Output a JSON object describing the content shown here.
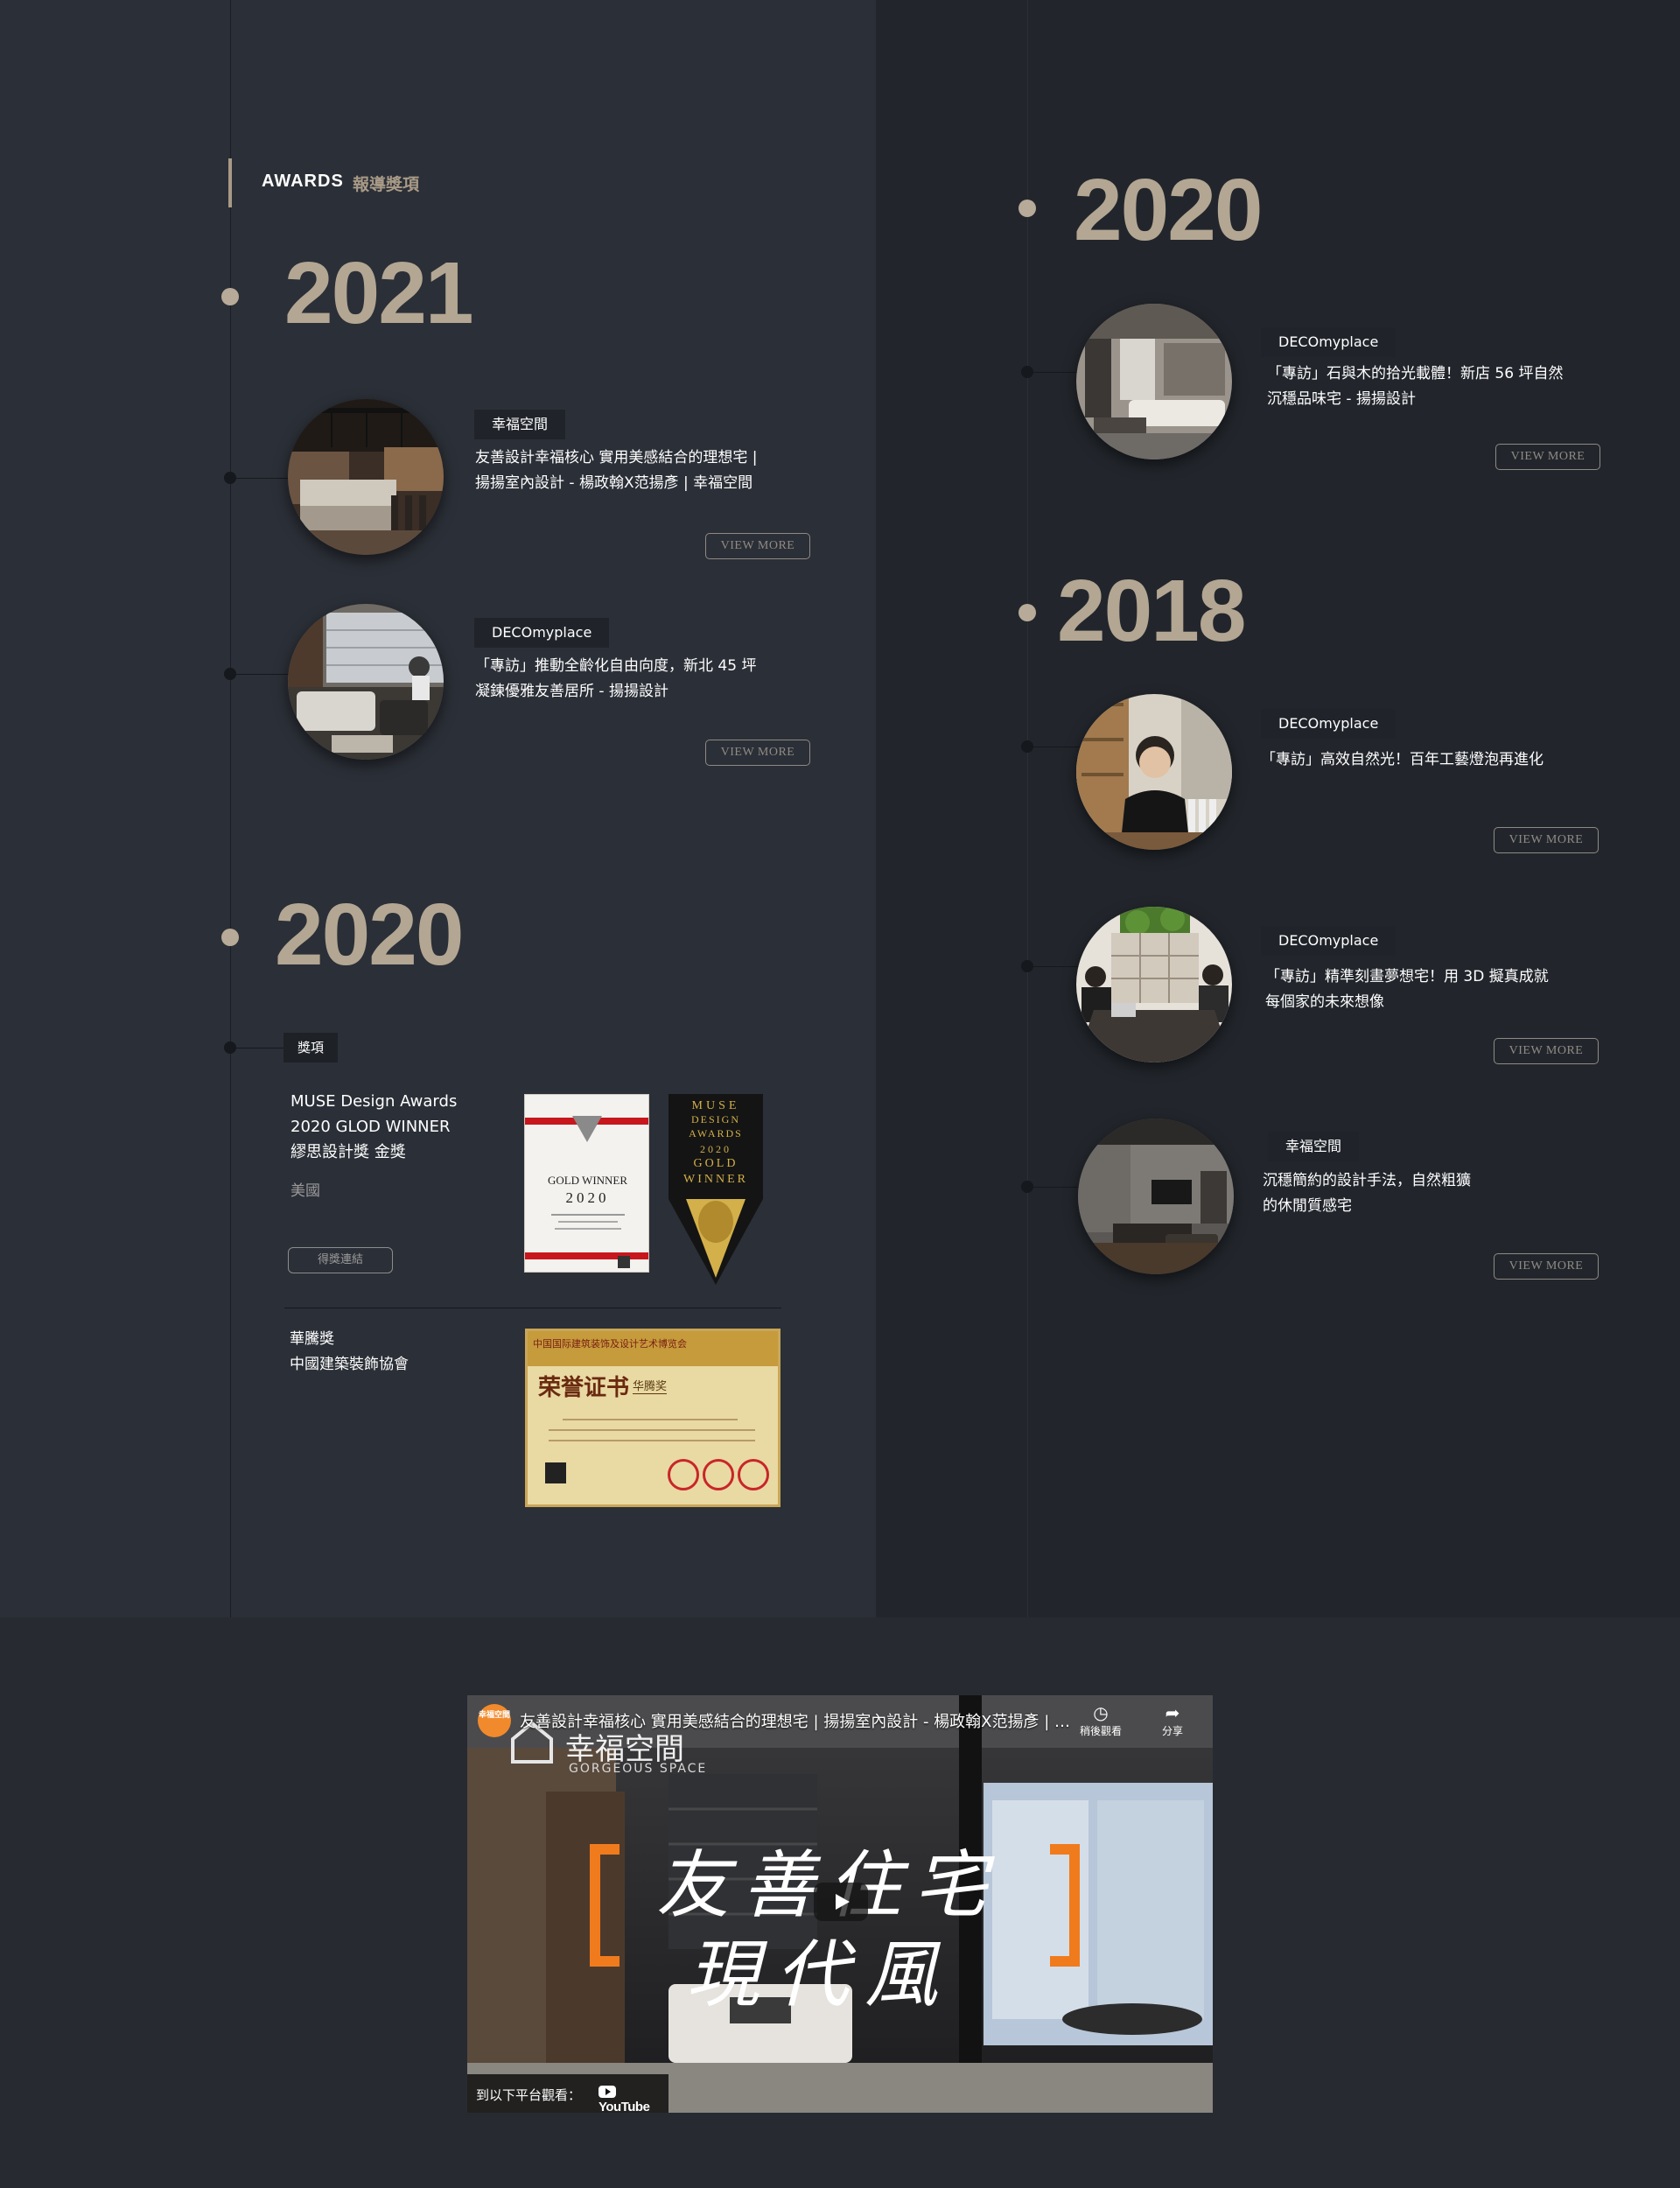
{
  "heading": {
    "en": "AWARDS",
    "zh": "報導獎項"
  },
  "left_column": {
    "year_2021": "2021",
    "articles_2021": [
      {
        "tag": "幸福空間",
        "title_line1": "友善設計幸福核心 實用美感結合的理想宅 |",
        "title_line2": "揚揚室內設計 - 楊政翰X范揚彥 | 幸福空間",
        "button": "VIEW MORE"
      },
      {
        "tag": "DECOmyplace",
        "title_line1": "「專訪」推動全齡化自由向度，新北 45 坪",
        "title_line2": "凝鍊優雅友善居所 - 揚揚設計",
        "button": "VIEW MORE"
      }
    ],
    "year_2020": "2020",
    "awards_tag": "獎項",
    "muse": {
      "line1": "MUSE Design Awards",
      "line2": "2020 GLOD WINNER",
      "line3": "繆思設計獎 金獎",
      "country": "美國",
      "link_label": "得獎連結",
      "cert_winner": "GOLD WINNER",
      "cert_year": "2020",
      "badge_lines": [
        "MUSE",
        "DESIGN",
        "AWARDS",
        "2020",
        "GOLD",
        "WINNER"
      ]
    },
    "huateng": {
      "line1": "華騰獎",
      "line2": "中國建築裝飾協會",
      "cert_header": "中国国际建筑装饰及设计艺术博览会",
      "cert_title": "荣誉证书",
      "cert_award": "华腾奖"
    }
  },
  "right_column": {
    "year_2020": "2020",
    "articles_2020": [
      {
        "tag": "DECOmyplace",
        "title_line1": "「專訪」石與木的拾光載體！新店 56 坪自然",
        "title_line2": "沉穩品味宅 - 揚揚設計",
        "button": "VIEW MORE"
      }
    ],
    "year_2018": "2018",
    "articles_2018": [
      {
        "tag": "DECOmyplace",
        "title_line1": "「專訪」高效自然光！百年工藝燈泡再進化",
        "title_line2": "",
        "button": "VIEW MORE"
      },
      {
        "tag": "DECOmyplace",
        "title_line1": "「專訪」精準刻畫夢想宅！用 3D 擬真成就",
        "title_line2": "每個家的未來想像",
        "button": "VIEW MORE"
      },
      {
        "tag": "幸福空間",
        "title_line1": "沉穩簡約的設計手法，自然粗獷",
        "title_line2": "的休閒質感宅",
        "button": "VIEW MORE"
      }
    ]
  },
  "video": {
    "channel_avatar": "幸福空間",
    "title": "友善設計幸福核心 實用美感結合的理想宅 | 揚揚室內設計 - 楊政翰X范揚彥 | 幸...",
    "watch_later": "稍後觀看",
    "share": "分享",
    "brand_zh": "幸福空間",
    "brand_en": "GORGEOUS SPACE",
    "calligraphy_line1": "友善住宅",
    "calligraphy_line2": "現代風",
    "watch_on": "到以下平台觀看：",
    "youtube": "YouTube",
    "accent_color": "#f07b1d"
  },
  "colors": {
    "year": "#b3a693",
    "left_bg": "#2b2f37",
    "right_bg": "#22262c",
    "tag_bg": "#20242a"
  }
}
